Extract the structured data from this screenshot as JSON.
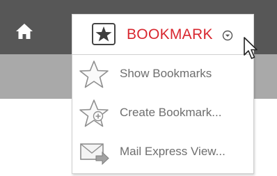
{
  "nav": {
    "home_icon": "home-icon",
    "bookmark_tab": {
      "label": "BOOKMARK",
      "icon": "star-icon",
      "dropdown_icon": "chevron-down-circle-icon",
      "label_color": "#d8262e"
    }
  },
  "menu": {
    "items": [
      {
        "label": "Show Bookmarks",
        "icon": "star-outline-icon"
      },
      {
        "label": "Create Bookmark...",
        "icon": "star-plus-icon"
      },
      {
        "label": "Mail Express View...",
        "icon": "mail-forward-icon"
      }
    ]
  },
  "colors": {
    "topbar": "#575757",
    "subbar": "#a9a9a9",
    "menu_text": "#6e6e6e"
  }
}
